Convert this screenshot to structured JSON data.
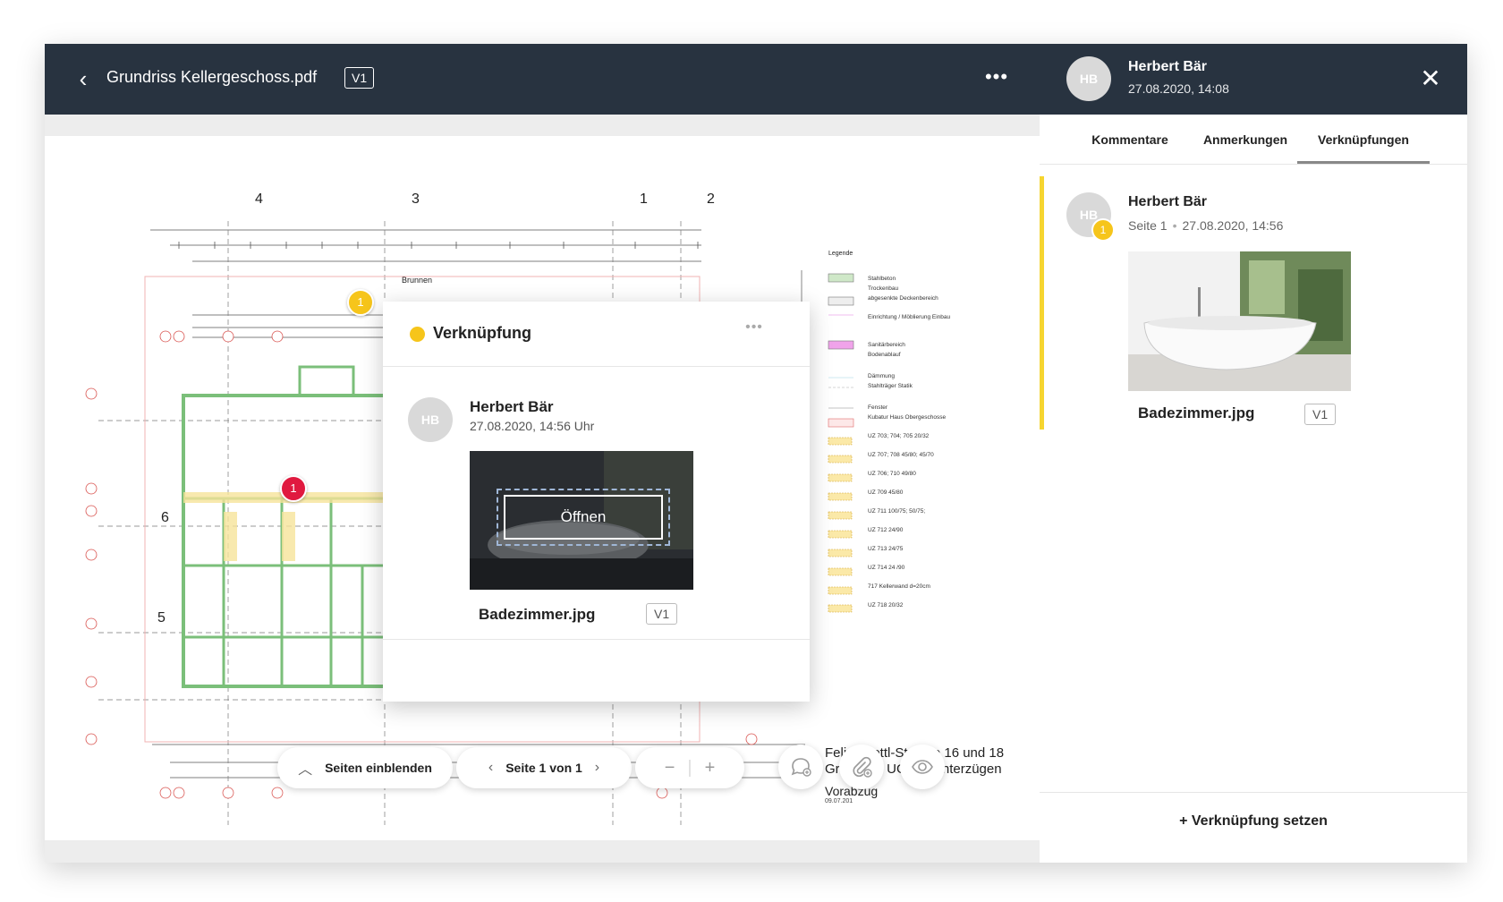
{
  "header": {
    "back_icon": "chevron-left-icon",
    "title": "Grundriss Kellergeschoss.pdf",
    "version": "V1",
    "more_icon": "more-horizontal-icon"
  },
  "plan": {
    "axis_labels": [
      "4",
      "3",
      "1",
      "2"
    ],
    "side_labels": [
      "6",
      "5"
    ],
    "room_label": "Brunnen",
    "legend_title": "Legende",
    "legend_items": [
      "Stahlbeton",
      "Trockenbau",
      "abgesenkte Deckenbereich",
      "Einrichtung / Möblierung Einbau",
      "Sanitärbereich",
      "Bodenablauf",
      "Dämmung",
      "Stahlträger Statik",
      "Fenster",
      "Kubatur Haus Obergeschosse",
      "UZ 703; 704; 705 20/32",
      "UZ 707; 708 45/80; 45/70",
      "UZ 706; 710 49/80",
      "UZ 709 45/80",
      "UZ 711 100/75; 50/75;",
      "UZ 712 24/90",
      "UZ 713 24/75",
      "UZ 714 24 /90",
      "717 Kellerwand d=20cm",
      "UZ 718 20/32"
    ],
    "pin_yellow": "1",
    "pin_red": "1"
  },
  "address": {
    "line1": "Felix- Mottl-Strasse 16 und 18",
    "line2": "Grundriss UG mit Unterzügen",
    "line3": "Vorabzug",
    "line4": "09.07.201"
  },
  "popup": {
    "title": "Verknüpfung",
    "author_initials": "HB",
    "author_name": "Herbert Bär",
    "date": "27.08.2020, 14:56 Uhr",
    "open_label": "Öffnen",
    "file_name": "Badezimmer.jpg",
    "file_version": "V1"
  },
  "toolbar": {
    "pages_toggle": "Seiten einblenden",
    "page_indicator": "Seite 1 von 1",
    "zoom_out_icon": "minus-icon",
    "zoom_in_icon": "plus-icon",
    "comment_icon": "comment-add-icon",
    "attach_icon": "attachment-add-icon",
    "view_icon": "eye-icon"
  },
  "sidepanel": {
    "author_initials": "HB",
    "author_name": "Herbert Bär",
    "date": "27.08.2020, 14:08",
    "tabs": [
      "Kommentare",
      "Anmerkungen",
      "Verknüpfungen"
    ],
    "active_tab": "Verknüpfungen",
    "item": {
      "initials": "HB",
      "pin": "1",
      "name": "Herbert Bär",
      "page": "Seite 1",
      "date": "27.08.2020, 14:56",
      "file_name": "Badezimmer.jpg",
      "file_version": "V1"
    },
    "add_link": "+ Verknüpfung setzen"
  },
  "colors": {
    "header_bg": "#283340",
    "accent_yellow": "#f6c51b",
    "pin_red": "#e0193f",
    "plan_green": "#7bbf7a"
  }
}
